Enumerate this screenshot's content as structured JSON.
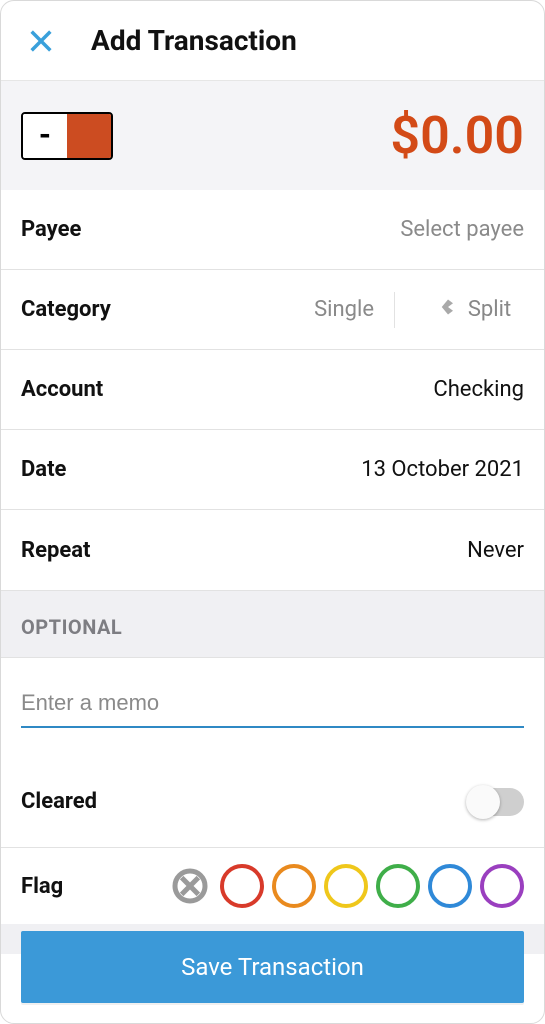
{
  "header": {
    "title": "Add Transaction"
  },
  "amount": {
    "sign": "-",
    "display": "$0.00"
  },
  "rows": {
    "payee": {
      "label": "Payee",
      "value": "Select payee"
    },
    "category": {
      "label": "Category",
      "value": "Single",
      "split_label": "Split"
    },
    "account": {
      "label": "Account",
      "value": "Checking"
    },
    "date": {
      "label": "Date",
      "value": "13 October 2021"
    },
    "repeat": {
      "label": "Repeat",
      "value": "Never"
    }
  },
  "optional_header": "OPTIONAL",
  "memo": {
    "placeholder": "Enter a memo"
  },
  "cleared": {
    "label": "Cleared",
    "on": false
  },
  "flag": {
    "label": "Flag",
    "colors": [
      "#d83a2a",
      "#e98a1e",
      "#efc71b",
      "#3fae49",
      "#2f89d8",
      "#9a3fbf"
    ]
  },
  "save_label": "Save Transaction"
}
